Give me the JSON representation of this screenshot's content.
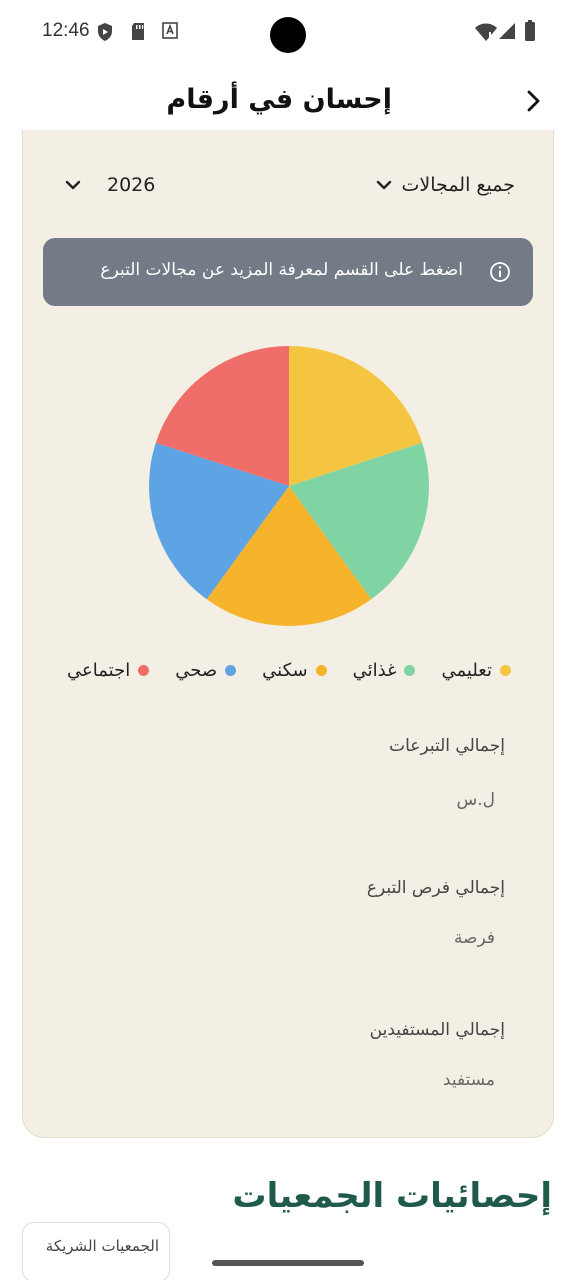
{
  "status_bar": {
    "time": "12:46"
  },
  "header": {
    "title": "إحسان في أرقام"
  },
  "filters": {
    "field_label": "جميع المجالات",
    "year_label": "2026"
  },
  "info_banner": {
    "text": "اضغط على القسم لمعرفة المزيد عن مجالات التبرع"
  },
  "chart_data": {
    "type": "pie",
    "categories": [
      "تعليمي",
      "غذائي",
      "سكني",
      "صحي",
      "اجتماعي"
    ],
    "values": [
      20,
      20,
      20,
      20,
      20
    ],
    "colors": [
      "#f5c542",
      "#80d4a4",
      "#f6b32c",
      "#5ea3e4",
      "#f06e6a"
    ]
  },
  "stats": [
    {
      "label": "إجمالي التبرعات",
      "unit": "ل.س"
    },
    {
      "label": "إجمالي فرص التبرع",
      "unit": "فرصة"
    },
    {
      "label": "إجمالي المستفيدين",
      "unit": "مستفيد"
    }
  ],
  "section": {
    "title": "إحصائيات الجمعيات",
    "partial_button": "الجمعيات الشريكة"
  },
  "icons": {
    "back": "chevron-right-icon",
    "dropdown": "chevron-down-icon",
    "info": "info-circle-icon"
  }
}
